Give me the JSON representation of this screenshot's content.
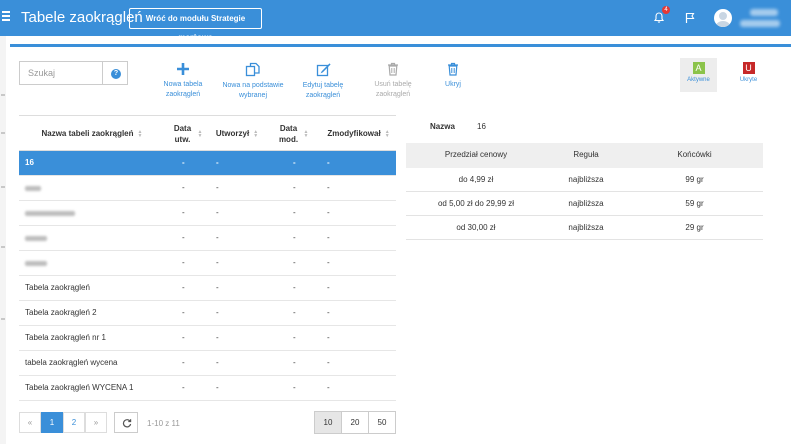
{
  "header": {
    "title": "Tabele zaokrągleń",
    "back_button": "Wróć do modułu Strategie marżowe",
    "notification_count": "4"
  },
  "search": {
    "placeholder": "Szukaj"
  },
  "toolbar": {
    "new_table": [
      "Nowa tabela",
      "zaokrągleń"
    ],
    "new_based": [
      "Nowa na podstawie",
      "wybranej"
    ],
    "edit": [
      "Edytuj tabelę",
      "zaokrągleń"
    ],
    "delete": [
      "Usuń tabelę",
      "zaokrągleń"
    ],
    "hide": "Ukryj"
  },
  "status_filters": {
    "active": {
      "letter": "A",
      "label": "Aktywne",
      "color": "#8bc34a"
    },
    "hidden": {
      "letter": "U",
      "label": "Ukryte",
      "color": "#c62828"
    }
  },
  "table": {
    "columns": [
      "Nazwa tabeli zaokrągleń",
      "Data utw.",
      "Utworzył",
      "Data mod.",
      "Zmodyfikował"
    ],
    "rows": [
      {
        "name": "16",
        "created": "-",
        "author": "-",
        "modified": "-",
        "modifier": "-",
        "selected": true
      },
      {
        "name": "",
        "created": "-",
        "author": "-",
        "modified": "-",
        "modifier": "-"
      },
      {
        "name": "",
        "created": "-",
        "author": "-",
        "modified": "-",
        "modifier": "-"
      },
      {
        "name": "",
        "created": "-",
        "author": "-",
        "modified": "-",
        "modifier": "-"
      },
      {
        "name": "",
        "created": "-",
        "author": "-",
        "modified": "-",
        "modifier": "-"
      },
      {
        "name": "Tabela zaokrągleń",
        "created": "-",
        "author": "-",
        "modified": "-",
        "modifier": "-"
      },
      {
        "name": "Tabela zaokrągleń 2",
        "created": "-",
        "author": "-",
        "modified": "-",
        "modifier": "-"
      },
      {
        "name": "Tabela zaokrągleń nr 1",
        "created": "-",
        "author": "-",
        "modified": "-",
        "modifier": "-"
      },
      {
        "name": "tabela zaokrągleń wycena",
        "created": "-",
        "author": "-",
        "modified": "-",
        "modifier": "-"
      },
      {
        "name": "Tabela zaokrągleń WYCENA 1",
        "created": "-",
        "author": "-",
        "modified": "-",
        "modifier": "-"
      }
    ]
  },
  "pagination": {
    "prev": "«",
    "pages": [
      "1",
      "2"
    ],
    "next": "»",
    "range": "1-10 z 11",
    "page_sizes": [
      "10",
      "20",
      "50"
    ]
  },
  "detail": {
    "name_label": "Nazwa",
    "name_value": "16",
    "columns": [
      "Przedział cenowy",
      "Reguła",
      "Końcówki"
    ],
    "rows": [
      [
        "do 4,99 zł",
        "najbliższa",
        "99 gr"
      ],
      [
        "od 5,00 zł do 29,99 zł",
        "najbliższa",
        "59 gr"
      ],
      [
        "od 30,00 zł",
        "najbliższa",
        "29 gr"
      ]
    ]
  },
  "colors": {
    "accent": "#3a8fd9"
  }
}
